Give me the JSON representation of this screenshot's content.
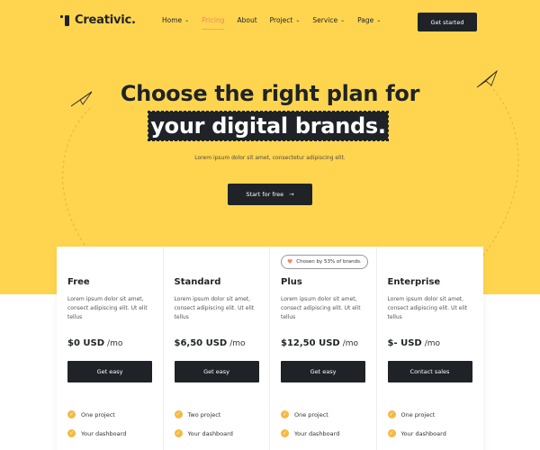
{
  "header": {
    "logo": "Creativic.",
    "nav": [
      {
        "label": "Home",
        "dropdown": true
      },
      {
        "label": "Pricing",
        "dropdown": false,
        "active": true
      },
      {
        "label": "About",
        "dropdown": false
      },
      {
        "label": "Project",
        "dropdown": true
      },
      {
        "label": "Service",
        "dropdown": true
      },
      {
        "label": "Page",
        "dropdown": true
      }
    ],
    "cta": "Get started"
  },
  "hero": {
    "headline_line1": "Choose the right plan for",
    "headline_line2": "your digital brands.",
    "subtitle": "Lorem ipsum dolor sit amet, consectetur adipiscing elit.",
    "cta": "Start for free",
    "cta_icon": "→"
  },
  "plans": [
    {
      "name": "Free",
      "description": "Lorem ipsum dolor sit amet, consect adipiscing elit. Ut elit tellus",
      "price": "$0 USD",
      "unit": "/mo",
      "button": "Get easy",
      "features": [
        "One project",
        "Your dashboard"
      ]
    },
    {
      "name": "Standard",
      "description": "Lorem ipsum dolor sit amet, consect adipiscing elit. Ut elit tellus",
      "price": "$6,50 USD",
      "unit": "/mo",
      "button": "Get easy",
      "features": [
        "Two project",
        "Your dashboard"
      ]
    },
    {
      "name": "Plus",
      "badge": "Chosen by 53% of brands.",
      "description": "Lorem ipsum dolor sit amet, consect adipiscing elit. Ut elit tellus",
      "price": "$12,50 USD",
      "unit": "/mo",
      "button": "Get easy",
      "features": [
        "One project",
        "Your dashboard"
      ]
    },
    {
      "name": "Enterprise",
      "description": "Lorem ipsum dolor sit amet, consect adipiscing elit. Ut elit tellus",
      "price": "$- USD",
      "unit": "/mo",
      "button": "Contact sales",
      "features": [
        "One project",
        "Your dashboard"
      ]
    }
  ],
  "colors": {
    "hero_bg": "#ffd54f",
    "dark": "#1f2327",
    "accent": "#f4845f",
    "check": "#f5b941"
  }
}
